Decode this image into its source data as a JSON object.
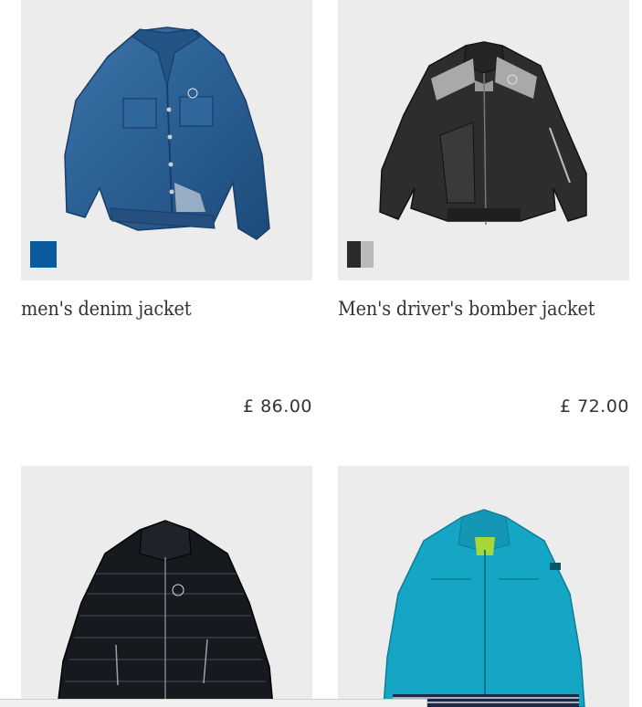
{
  "products": [
    {
      "name": "men's denim jacket",
      "price": "£ 86.00",
      "image_icon": "denim-jacket-image",
      "swatches": [
        [
          "#0b5a9e"
        ]
      ]
    },
    {
      "name": "Men's driver's bomber jacket",
      "price": "£ 72.00",
      "image_icon": "bomber-jacket-image",
      "swatches": [
        [
          "#2a2a2a",
          "#b9b9b9"
        ]
      ]
    },
    {
      "name": "",
      "price": "",
      "image_icon": "black-quilted-jacket-image"
    },
    {
      "name": "",
      "price": "",
      "image_icon": "turquoise-jacket-image"
    }
  ],
  "colors": {
    "image_background": "#ececec",
    "denim": "#2b5f93",
    "bomber_dark": "#2d2d2d",
    "bomber_grey": "#a9a9a9",
    "quilted_black": "#161a1f",
    "turquoise": "#15a6c6"
  }
}
